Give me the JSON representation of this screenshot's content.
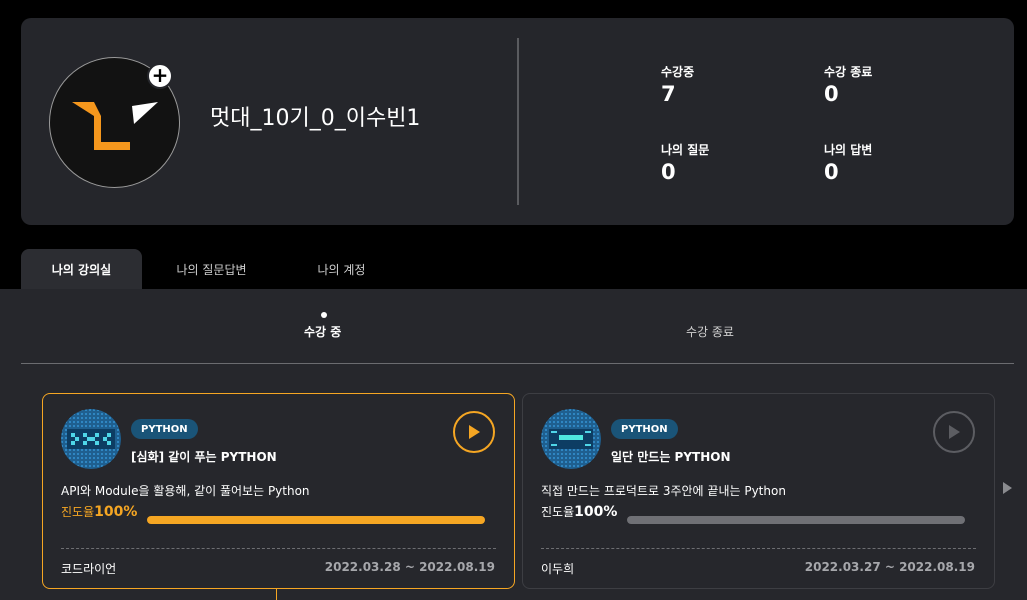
{
  "profile": {
    "username": "멋대_10기_0_이수빈1",
    "stats": [
      {
        "label": "수강중",
        "value": "7"
      },
      {
        "label": "수강 종료",
        "value": "0"
      },
      {
        "label": "나의 질문",
        "value": "0"
      },
      {
        "label": "나의 답변",
        "value": "0"
      }
    ]
  },
  "tabs": [
    "나의 강의실",
    "나의 질문답변",
    "나의 계정"
  ],
  "subtabs": [
    "수강 중",
    "수강 종료"
  ],
  "courses": [
    {
      "badge": "PYTHON",
      "title": "[심화] 같이 푸는 PYTHON",
      "description": "API와 Module을 활용해, 같이 풀어보는 Python",
      "progress_label": "진도율",
      "progress_pct": "100%",
      "progress": 1.0,
      "instructor": "코드라이언",
      "period": "2022.03.28 ~ 2022.08.19",
      "accent": "#f5a623"
    },
    {
      "badge": "PYTHON",
      "title": "일단 만드는 PYTHON",
      "description": "직접 만드는 프로덕트로 3주안에 끝내는 Python",
      "progress_label": "진도율",
      "progress_pct": "100%",
      "progress": 1.0,
      "instructor": "이두희",
      "period": "2022.03.27 ~ 2022.08.19",
      "accent": "#6f7075"
    }
  ],
  "colors": {
    "background": "#000000",
    "card": "#25262b",
    "accent": "#f5a623",
    "badge": "#1a5478"
  },
  "icons": [
    "plus-icon",
    "play-icon",
    "chevron-right-icon"
  ]
}
